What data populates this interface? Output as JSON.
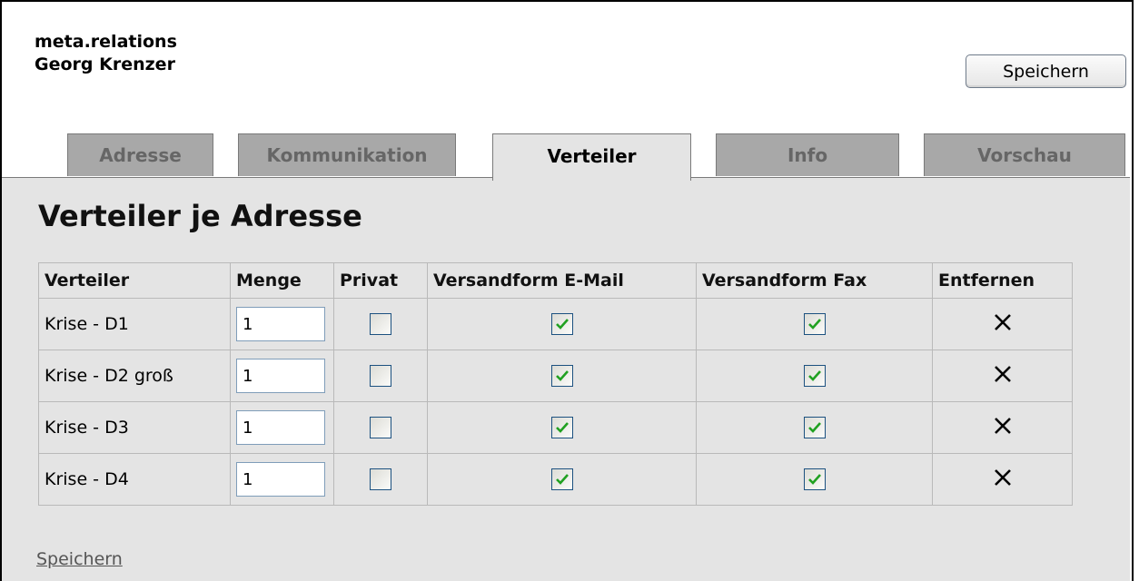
{
  "header": {
    "org": "meta.relations",
    "name": "Georg Krenzer",
    "save_label": "Speichern"
  },
  "tabs": [
    {
      "label": "Adresse",
      "active": false
    },
    {
      "label": "Kommunikation",
      "active": false
    },
    {
      "label": "Verteiler",
      "active": true
    },
    {
      "label": "Info",
      "active": false
    },
    {
      "label": "Vorschau",
      "active": false
    }
  ],
  "panel": {
    "title": "Verteiler je Adresse",
    "columns": [
      "Verteiler",
      "Menge",
      "Privat",
      "Versandform E-Mail",
      "Versandform Fax",
      "Entfernen"
    ],
    "rows": [
      {
        "verteiler": "Krise - D1",
        "menge": "1",
        "privat": false,
        "email": true,
        "fax": true
      },
      {
        "verteiler": "Krise - D2 groß",
        "menge": "1",
        "privat": false,
        "email": true,
        "fax": true
      },
      {
        "verteiler": "Krise - D3",
        "menge": "1",
        "privat": false,
        "email": true,
        "fax": true
      },
      {
        "verteiler": "Krise - D4",
        "menge": "1",
        "privat": false,
        "email": true,
        "fax": true
      }
    ],
    "remove_icon": "close-x-icon",
    "save_link": "Speichern"
  },
  "colors": {
    "panel_bg": "#e4e4e4",
    "tab_inactive_bg": "#a8a8a8",
    "check_green": "#21a121",
    "checkbox_border": "#1c5180"
  }
}
